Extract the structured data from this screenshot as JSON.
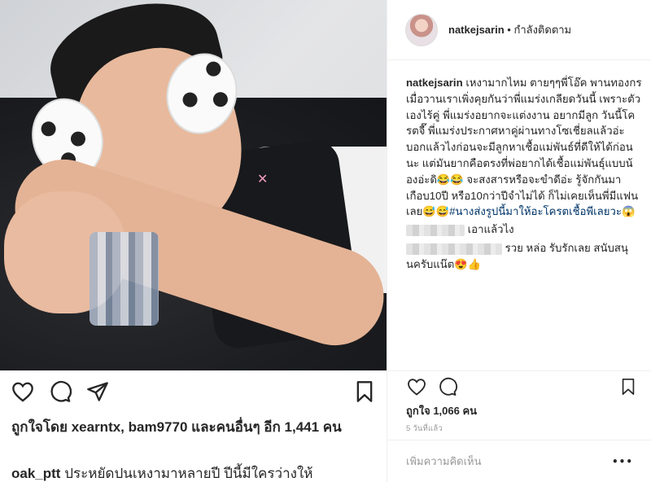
{
  "left": {
    "photo_alt": "",
    "likes_text": "ถูกใจโดย xearntx, bam9770 และคนอื่นๆ อีก 1,441 คน",
    "comment_user": "oak_ptt",
    "comment_text": "ประหยัดปนเหงามาหลายปี ปีนี้มีใครว่างให้"
  },
  "right": {
    "username": "natkejsarin",
    "follow_status": "• กำลังติดตาม",
    "caption_user": "natkejsarin",
    "caption_text": "เหงามากไหม ตายๆๆพี่โอ๊ค พานทองกร เมื่อวานเราเพิ่งคุยกันว่าพี่แมร่งเกลียดวันนี้ เพราะตัวเองไร้คู่ พี่แมร่งอยากจะแต่งงาน อยากมีลูก วันนี้โครตจี๊ พี่แมร่งประกาศหาคู่ผ่านทางโซเชี่ยลแล้วอ่ะ บอกแล้วไงก่อนจะมีลูกหาเชื้อแม่พันธ์ที่ดีให้ได้ก่อนนะ แต่มันยากคือตรงที่พ่อยากได้เชื้อแม่พันธุ์แบบน้องอ่ะดิ😂😂 จะสงสารหรือจะขำดีอ่ะ รู้จักกันมาเกือบ10ปี หรือ10กว่าปีจำไม่ได้ ก็ไม่เคยเห็นพี่มีแฟนเลย😅😅",
    "caption_hashtag": "#นางส่งรูปนี้มาให้อะโครตเชื้อพีเลยวะ",
    "caption_end_emoji": "😱",
    "comments": [
      {
        "text": "เอาแล้วไง"
      },
      {
        "text": "รวย หล่อ รับรักเลย สนับสนุนครับแน๊ต😍👍"
      }
    ],
    "likes_text": "ถูกใจ 1,066 คน",
    "time_text": "5 วันที่แล้ว",
    "add_comment_placeholder": "เพิ่มความคิดเห็น",
    "more_label": "•••"
  },
  "icons": {
    "like": "heart-icon",
    "comment": "comment-bubble-icon",
    "share": "paper-plane-icon",
    "save": "bookmark-icon",
    "more": "ellipsis-icon"
  }
}
